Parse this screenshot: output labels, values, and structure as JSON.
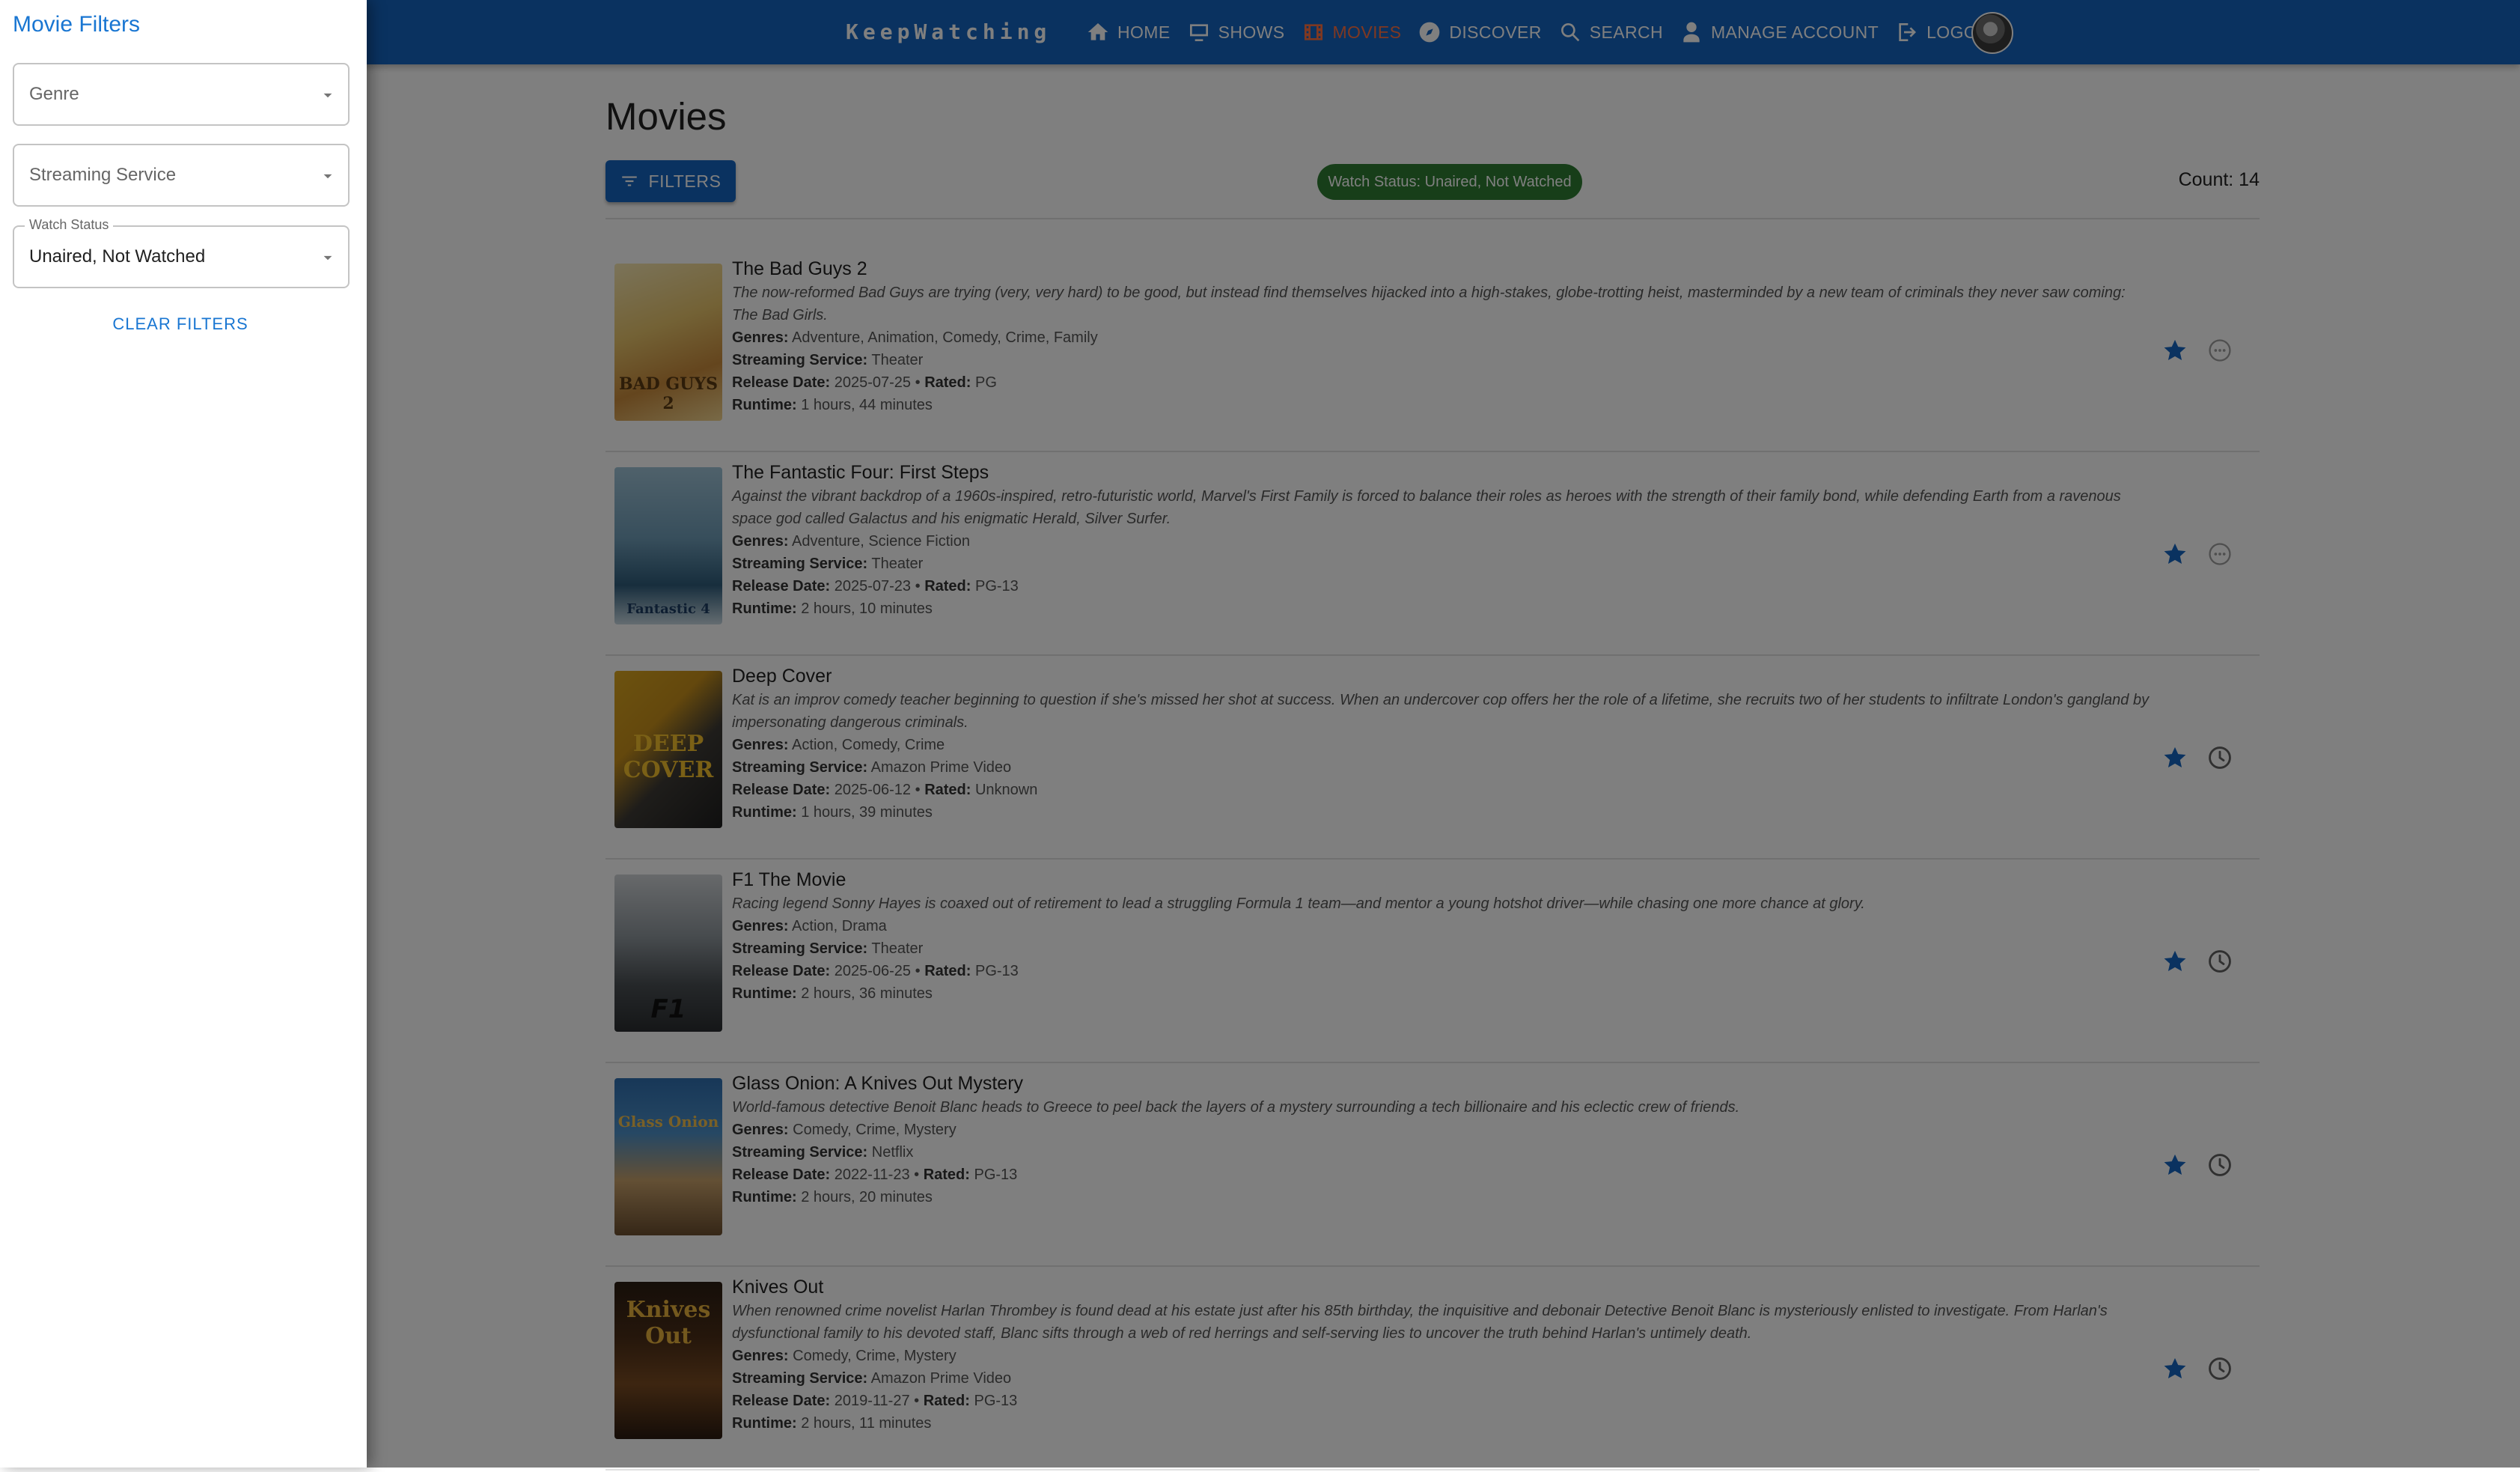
{
  "app": {
    "brand": "KeepWatching",
    "nav": [
      {
        "label": "HOME",
        "icon": "home-icon"
      },
      {
        "label": "SHOWS",
        "icon": "tv-icon"
      },
      {
        "label": "MOVIES",
        "icon": "film-icon"
      },
      {
        "label": "DISCOVER",
        "icon": "compass-icon"
      },
      {
        "label": "SEARCH",
        "icon": "search-icon"
      },
      {
        "label": "MANAGE ACCOUNT",
        "icon": "user-icon"
      },
      {
        "label": "LOGOUT",
        "icon": "logout-icon"
      }
    ],
    "active_nav": "MOVIES"
  },
  "page": {
    "title": "Movies",
    "filters_button": "FILTERS",
    "status_chip": "Watch Status: Unaired, Not Watched",
    "count": "Count: 14"
  },
  "field_labels": {
    "genres": "Genres:",
    "streaming": "Streaming Service:",
    "release": "Release Date:",
    "rated": "Rated:",
    "runtime": "Runtime:"
  },
  "movies": [
    {
      "title": "The Bad Guys 2",
      "description": "The now-reformed Bad Guys are trying (very, very hard) to be good, but instead find themselves hijacked into a high-stakes, globe-trotting heist, masterminded by a new team of criminals they never saw coming: The Bad Girls.",
      "genres": "Adventure, Animation, Comedy, Crime, Family",
      "streaming_service": "Theater",
      "release_date": "2025-07-25",
      "rated": "PG",
      "runtime": "1 hours, 44 minutes",
      "favorite": true,
      "status_icon": "unaired-icon"
    },
    {
      "title": "The Fantastic Four: First Steps",
      "description": "Against the vibrant backdrop of a 1960s-inspired, retro-futuristic world, Marvel's First Family is forced to balance their roles as heroes with the strength of their family bond, while defending Earth from a ravenous space god called Galactus and his enigmatic Herald, Silver Surfer.",
      "genres": "Adventure, Science Fiction",
      "streaming_service": "Theater",
      "release_date": "2025-07-23",
      "rated": "PG-13",
      "runtime": "2 hours, 10 minutes",
      "favorite": true,
      "status_icon": "unaired-icon"
    },
    {
      "title": "Deep Cover",
      "description": "Kat is an improv comedy teacher beginning to question if she's missed her shot at success. When an undercover cop offers her the role of a lifetime, she recruits two of her students to infiltrate London's gangland by impersonating dangerous criminals.",
      "genres": "Action, Comedy, Crime",
      "streaming_service": "Amazon Prime Video",
      "release_date": "2025-06-12",
      "rated": "Unknown",
      "runtime": "1 hours, 39 minutes",
      "favorite": true,
      "status_icon": "not-watched-clock-icon"
    },
    {
      "title": "F1 The Movie",
      "description": "Racing legend Sonny Hayes is coaxed out of retirement to lead a struggling Formula 1 team—and mentor a young hotshot driver—while chasing one more chance at glory.",
      "genres": "Action, Drama",
      "streaming_service": "Theater",
      "release_date": "2025-06-25",
      "rated": "PG-13",
      "runtime": "2 hours, 36 minutes",
      "favorite": true,
      "status_icon": "not-watched-clock-icon"
    },
    {
      "title": "Glass Onion: A Knives Out Mystery",
      "description": "World-famous detective Benoit Blanc heads to Greece to peel back the layers of a mystery surrounding a tech billionaire and his eclectic crew of friends.",
      "genres": "Comedy, Crime, Mystery",
      "streaming_service": "Netflix",
      "release_date": "2022-11-23",
      "rated": "PG-13",
      "runtime": "2 hours, 20 minutes",
      "favorite": true,
      "status_icon": "not-watched-clock-icon"
    },
    {
      "title": "Knives Out",
      "description": "When renowned crime novelist Harlan Thrombey is found dead at his estate just after his 85th birthday, the inquisitive and debonair Detective Benoit Blanc is mysteriously enlisted to investigate. From Harlan's dysfunctional family to his devoted staff, Blanc sifts through a web of red herrings and self-serving lies to uncover the truth behind Harlan's untimely death.",
      "genres": "Comedy, Crime, Mystery",
      "streaming_service": "Amazon Prime Video",
      "release_date": "2019-11-27",
      "rated": "PG-13",
      "runtime": "2 hours, 11 minutes",
      "favorite": true,
      "status_icon": "not-watched-clock-icon"
    }
  ],
  "drawer": {
    "title": "Movie Filters",
    "genre_placeholder": "Genre",
    "streaming_placeholder": "Streaming Service",
    "watch_status_label": "Watch Status",
    "watch_status_value": "Unaired, Not Watched",
    "clear_button": "CLEAR FILTERS"
  },
  "colors": {
    "appbar": "#1565c0",
    "active_nav": "#ff7043",
    "chip": "#2e7d32",
    "accent": "#1976d2"
  }
}
